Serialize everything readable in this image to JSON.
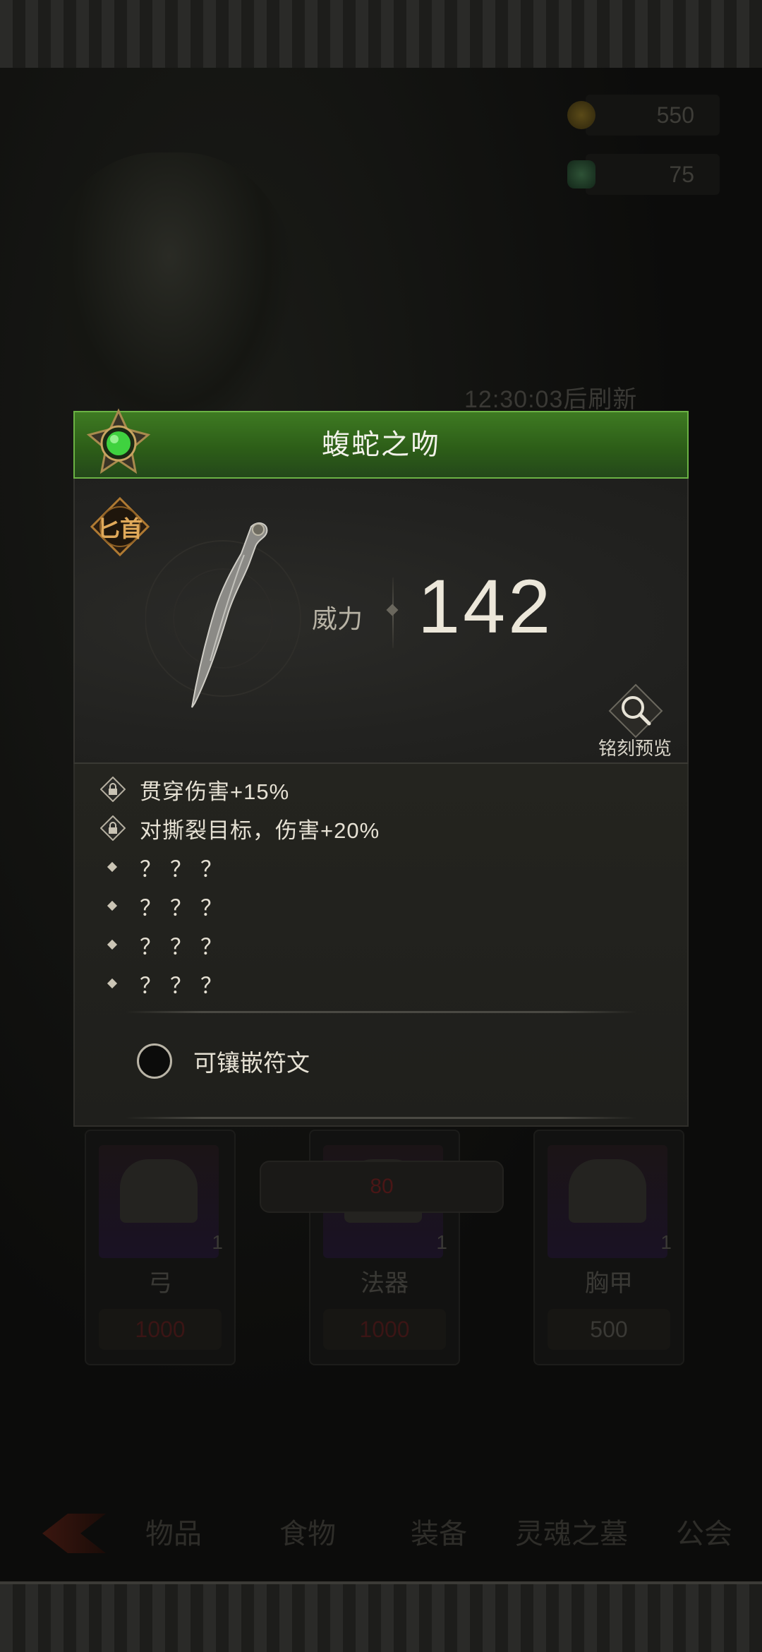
{
  "background": {
    "currency": [
      {
        "icon": "gold-coin-icon",
        "value": "550"
      },
      {
        "icon": "soul-gem-icon",
        "value": "75"
      }
    ],
    "refresh_text": "12:30:03后刷新",
    "shop_slots": [
      {
        "name": "弓",
        "qty": "1",
        "price": "1000"
      },
      {
        "name": "法器",
        "qty": "1",
        "price": "1000"
      },
      {
        "name": "胸甲",
        "qty": "1",
        "price": "500"
      }
    ],
    "cost_pill": "80",
    "tabs": [
      "物品",
      "食物",
      "装备",
      "灵魂之墓",
      "公会"
    ]
  },
  "item": {
    "name": "蝮蛇之吻",
    "type": "匕首",
    "power_label": "威力",
    "power_value": "142",
    "rarity_color": "#4caf2e",
    "preview_label": "铭刻预览",
    "affixes": [
      {
        "locked": true,
        "text": "贯穿伤害+15%"
      },
      {
        "locked": true,
        "text": "对撕裂目标，伤害+20%"
      },
      {
        "locked": false,
        "text": "？？？"
      },
      {
        "locked": false,
        "text": "？？？"
      },
      {
        "locked": false,
        "text": "？？？"
      },
      {
        "locked": false,
        "text": "？？？"
      }
    ],
    "rune_label": "可镶嵌符文"
  }
}
